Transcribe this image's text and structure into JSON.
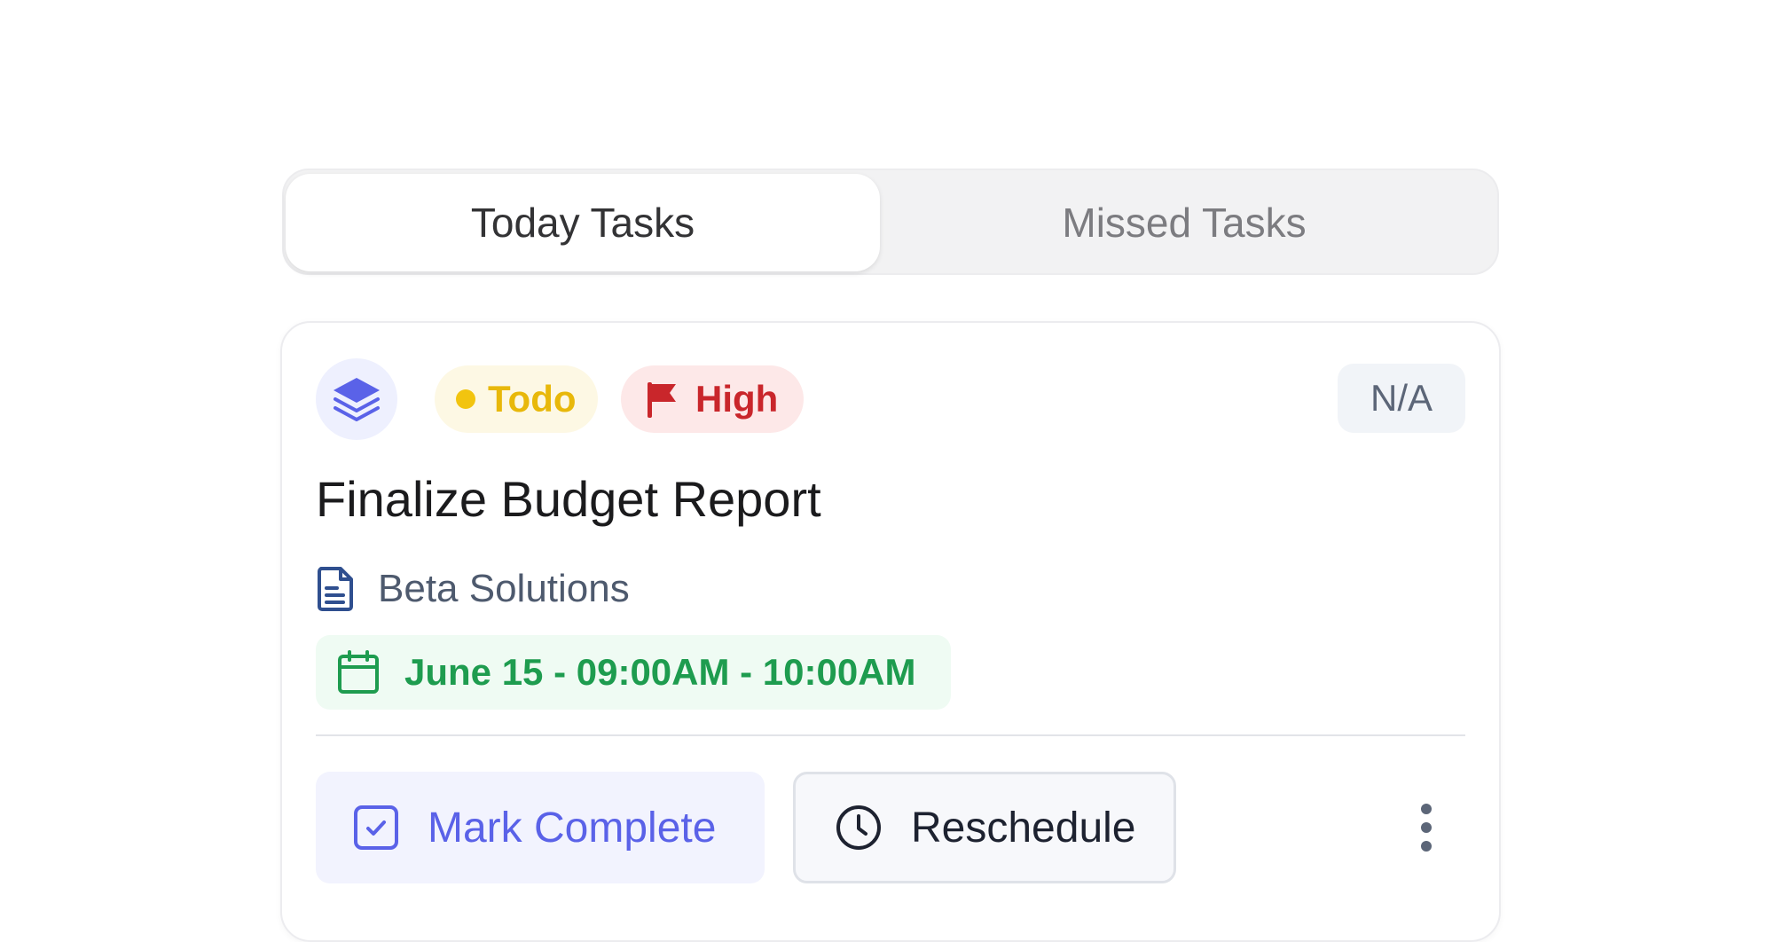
{
  "tabs": [
    {
      "label": "Today Tasks",
      "active": true
    },
    {
      "label": "Missed Tasks",
      "active": false
    }
  ],
  "task": {
    "icon": "layers-icon",
    "status": {
      "label": "Todo",
      "color": "#f2c40f"
    },
    "priority": {
      "label": "High",
      "icon": "flag-icon",
      "color": "#c9262b"
    },
    "assignee": "N/A",
    "title": "Finalize Budget Report",
    "company": {
      "icon": "document-icon",
      "name": "Beta Solutions"
    },
    "schedule": {
      "icon": "calendar-icon",
      "text": "June 15 - 09:00AM - 10:00AM",
      "color": "#1e9c4f"
    },
    "actions": {
      "complete": {
        "label": "Mark Complete",
        "icon": "check-square-icon",
        "color": "#5a62e8"
      },
      "reschedule": {
        "label": "Reschedule",
        "icon": "clock-icon"
      },
      "more": {
        "icon": "more-vertical-icon"
      }
    }
  },
  "colors": {
    "accent": "#5a62e8",
    "success": "#1e9c4f",
    "danger": "#c9262b",
    "warning": "#f2c40f"
  }
}
